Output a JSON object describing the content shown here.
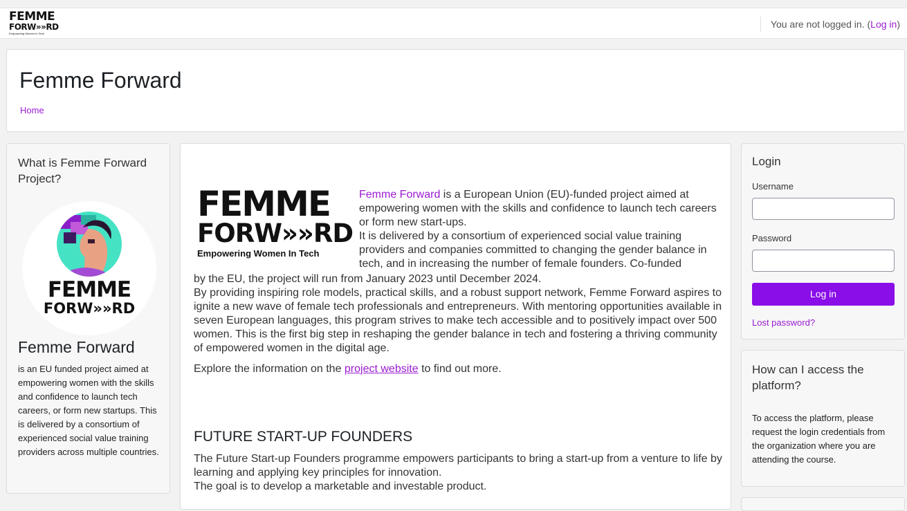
{
  "topbar": {
    "logo_line1": "FEMME",
    "logo_line2": "FORW»»RD",
    "logo_line3": "Empowering Women In Tech",
    "status_text": "You are not logged in.",
    "login_link": "Log in"
  },
  "header": {
    "title": "Femme Forward",
    "breadcrumb": "Home"
  },
  "left_block": {
    "title": "What is Femme Forward Project?",
    "logo_line1": "FEMME",
    "logo_line2": "FORW»»RD",
    "heading": "Femme Forward",
    "text": "is an EU funded project aimed at empowering women with the skills and confidence to launch tech careers, or form new startups. This is delivered by a consortium of experienced social value training providers across multiple countries."
  },
  "main": {
    "logo_line1": "FEMME",
    "logo_line2": "FORW»»RD",
    "logo_line3": "Empowering Women In Tech",
    "intro_highlight": "Femme Forward",
    "intro_rest": " is a European Union (EU)-funded project aimed at empowering women with the skills and confidence to launch tech careers or form new start-ups.",
    "consortium": "It is delivered by a consortium of experienced social value training providers and companies committed to changing the gender balance in tech, and in increasing the number of female founders. Co-funded",
    "funded": "by the EU, the project will run from January 2023 until December 2024.",
    "mission": "By providing inspiring role models, practical skills, and a robust support network, Femme Forward aspires to ignite a new wave of female tech professionals and entrepreneurs. With mentoring opportunities available in seven European languages, this program strives to make tech accessible and to positively impact over 500 women. This is the first big step in reshaping the gender balance in tech and fostering a thriving community of empowered women in the digital age.",
    "explore_pre": "Explore the information on the ",
    "explore_link": "project website",
    "explore_post": " to find out more.",
    "section_title": "FUTURE START-UP FOUNDERS",
    "section_p1": "The Future Start-up Founders programme empowers participants to bring a start-up from a venture to life by learning and applying key principles for innovation.",
    "section_p2": "The goal is to develop a marketable and investable product."
  },
  "login": {
    "title": "Login",
    "username_label": "Username",
    "password_label": "Password",
    "button": "Log in",
    "lost_password": "Lost password?"
  },
  "access": {
    "title": "How can I access the platform?",
    "text": "To access the platform, please request the login credentials from the organization where you are attending the course."
  },
  "colors": {
    "accent": "#9b1bd1",
    "button": "#8a0ee8",
    "background": "#f2f2f3"
  }
}
